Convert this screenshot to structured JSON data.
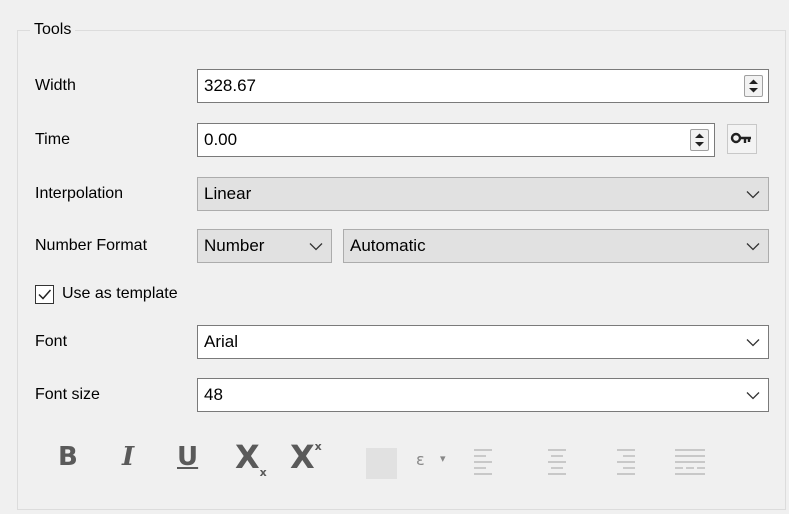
{
  "panel": {
    "title": "Tools"
  },
  "width": {
    "label": "Width",
    "value": "328.67"
  },
  "time": {
    "label": "Time",
    "value": "0.00"
  },
  "interpolation": {
    "label": "Interpolation",
    "value": "Linear"
  },
  "number_format": {
    "label": "Number Format",
    "type_value": "Number",
    "format_value": "Automatic"
  },
  "template": {
    "label": "Use as template",
    "checked": true
  },
  "font": {
    "label": "Font",
    "value": "Arial"
  },
  "font_size": {
    "label": "Font size",
    "value": "48"
  },
  "toolbar": {
    "bold": "B",
    "italic": "I",
    "underline": "U",
    "subscript_main": "X",
    "subscript_small": "x",
    "superscript_main": "X",
    "superscript_small": "x",
    "epsilon": "ε",
    "epsilon_caret": "▾",
    "icons": [
      "bold-icon",
      "italic-icon",
      "underline-icon",
      "subscript-icon",
      "superscript-icon",
      "color-swatch",
      "epsilon-icon",
      "align-left-icon",
      "align-center-icon",
      "align-right-icon",
      "align-justify-icon"
    ]
  },
  "colors": {
    "background": "#f0f0f0",
    "disabled_combo": "#e1e1e1",
    "toolbar_icon": "#5a5a5a"
  }
}
